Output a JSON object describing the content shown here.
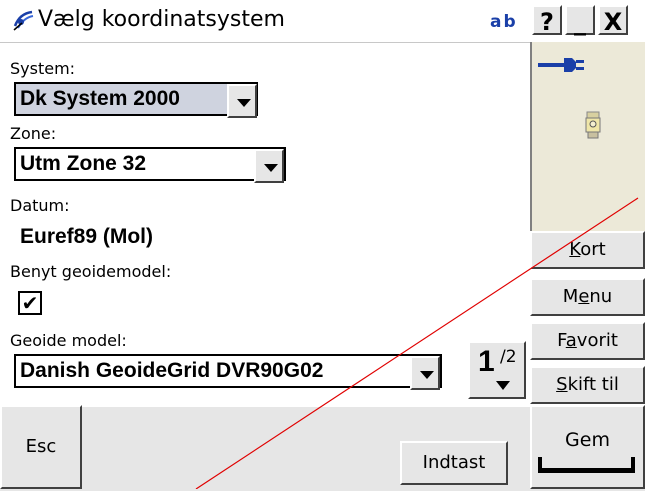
{
  "window": {
    "title": "Vælg koordinatsystem",
    "ab_badge": "ab",
    "help_label": "?",
    "minimize_label": "_",
    "close_label": "X"
  },
  "form": {
    "system_label": "System:",
    "system_value": "Dk System 2000",
    "zone_label": "Zone:",
    "zone_value": "Utm Zone 32",
    "datum_label": "Datum:",
    "datum_value": "Euref89 (Mol)",
    "geoid_use_label": "Benyt geoidemodel:",
    "geoid_use_checked": true,
    "check_mark": "✔",
    "geoid_model_label": "Geoide model:",
    "geoid_model_value": "Danish GeoideGrid DVR90G02"
  },
  "pager": {
    "page": "1",
    "total": "/2"
  },
  "side_buttons": [
    {
      "name": "kort",
      "first": "K",
      "rest": "ort"
    },
    {
      "name": "menu",
      "pre": "M",
      "u": "e",
      "post": "nu"
    },
    {
      "name": "favorit",
      "pre": "F",
      "u": "a",
      "post": "vorit"
    },
    {
      "name": "skift-til",
      "u": "S",
      "post": "kift til"
    }
  ],
  "bottom": {
    "esc_label": "Esc",
    "indtast_label": "Indtast",
    "gem_label": "Gem"
  },
  "colors": {
    "accent_blue": "#1a3fa8",
    "selection_bg": "#cfd3df",
    "button_face": "#e6e6e6",
    "panel_bg": "#ece9d8",
    "annotation_line": "#e00000"
  },
  "icons": {
    "title": "satellite-dish-icon",
    "status_power": "power-plug-icon",
    "status_instrument": "total-station-icon"
  }
}
